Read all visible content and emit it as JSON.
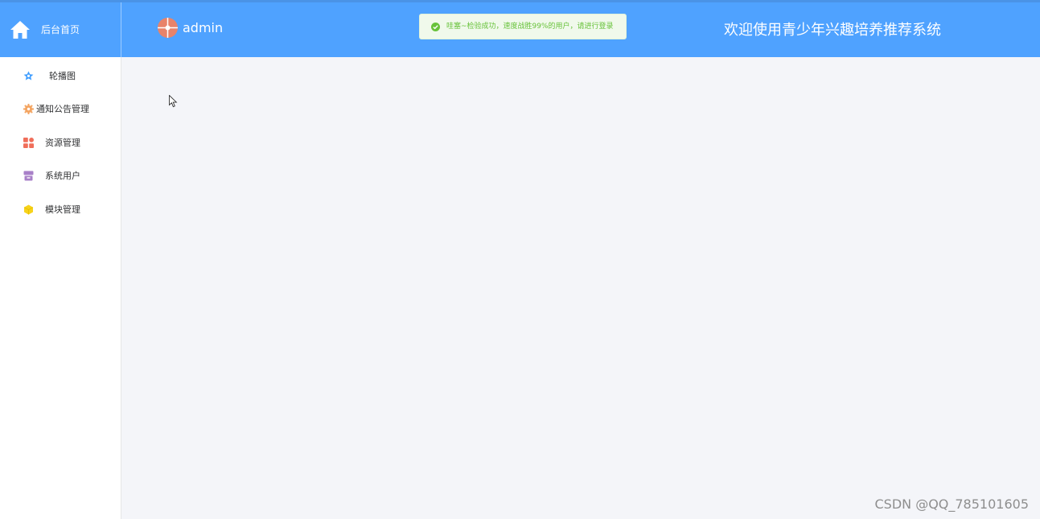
{
  "header": {
    "brand_title": "后台首页",
    "username": "admin",
    "welcome": "欢迎使用青少年兴趣培养推荐系统",
    "background_color": "#4fa2ff"
  },
  "toast": {
    "text": "哇塞~检验成功，速度战胜99%的用户，请进行登录",
    "type": "success",
    "color": "#67c23a"
  },
  "sidebar": {
    "items": [
      {
        "label": "轮播图",
        "icon": "star-icon",
        "color": "#409eff"
      },
      {
        "label": "通知公告管理",
        "icon": "gear-icon",
        "color": "#f4a460"
      },
      {
        "label": "资源管理",
        "icon": "grid-icon",
        "color": "#f06e5a"
      },
      {
        "label": "系统用户",
        "icon": "archive-icon",
        "color": "#a880c8"
      },
      {
        "label": "模块管理",
        "icon": "cube-icon",
        "color": "#f7d31b"
      }
    ]
  },
  "watermark": "CSDN @QQ_785101605"
}
